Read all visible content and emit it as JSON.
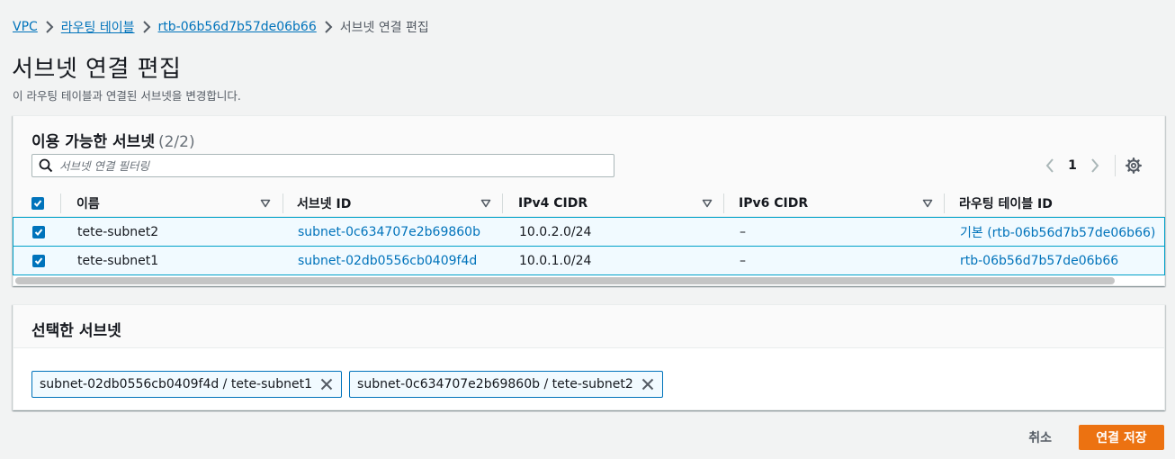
{
  "breadcrumb": {
    "items": [
      "VPC",
      "라우팅 테이블",
      "rtb-06b56d7b57de06b66"
    ],
    "current": "서브넷 연결 편집"
  },
  "page": {
    "title": "서브넷 연결 편집",
    "description": "이 라우팅 테이블과 연결된 서브넷을 변경합니다."
  },
  "available": {
    "title": "이용 가능한 서브넷",
    "count": "(2/2)",
    "filter_placeholder": "서브넷 연결 필터링",
    "page_number": "1",
    "columns": [
      "이름",
      "서브넷 ID",
      "IPv4 CIDR",
      "IPv6 CIDR",
      "라우팅 테이블 ID"
    ],
    "rows": [
      {
        "name": "tete-subnet2",
        "subnet_id": "subnet-0c634707e2b69860b",
        "ipv4": "10.0.2.0/24",
        "ipv6": "–",
        "route_table": "기본 (rtb-06b56d7b57de06b66)",
        "checked": true
      },
      {
        "name": "tete-subnet1",
        "subnet_id": "subnet-02db0556cb0409f4d",
        "ipv4": "10.0.1.0/24",
        "ipv6": "–",
        "route_table": "rtb-06b56d7b57de06b66",
        "checked": true
      }
    ]
  },
  "selected": {
    "title": "선택한 서브넷",
    "tokens": [
      "subnet-02db0556cb0409f4d / tete-subnet1",
      "subnet-0c634707e2b69860b / tete-subnet2"
    ]
  },
  "actions": {
    "cancel": "취소",
    "save": "연결 저장"
  },
  "colors": {
    "primary_button": "#ec7211",
    "link": "#0073bb",
    "selected_row_bg": "#f1faff",
    "selected_row_border": "#00a1c9"
  }
}
